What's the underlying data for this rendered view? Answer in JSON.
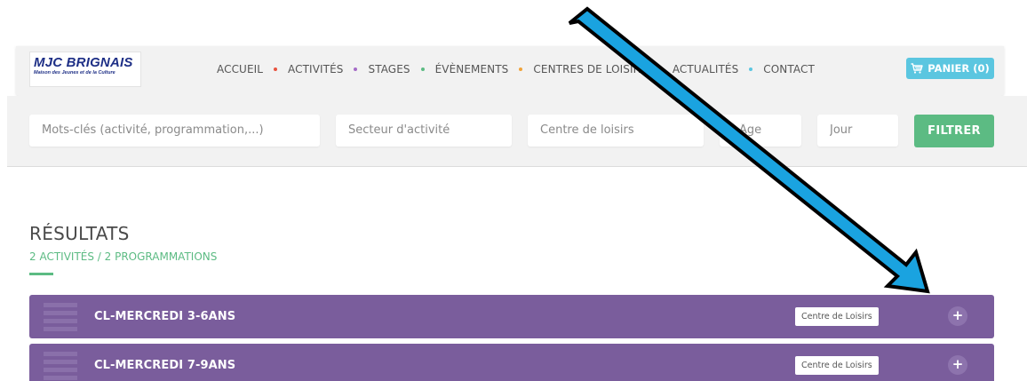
{
  "logo": {
    "title": "MJC BRIGNAIS",
    "subtitle": "Maison des Jeunes et de la Culture"
  },
  "nav": {
    "items": [
      {
        "label": "ACCUEIL",
        "dot": "#e8533f"
      },
      {
        "label": "ACTIVITÉS",
        "dot": "#a46bc7"
      },
      {
        "label": "STAGES",
        "dot": "#5cbb83"
      },
      {
        "label": "ÉVÈNEMENTS",
        "dot": "#f0a33a"
      },
      {
        "label": "CENTRES DE LOISIRS",
        "dot": "#f0a33a"
      },
      {
        "label": "ACTUALITÉS",
        "dot": "#5bc6e0"
      },
      {
        "label": "CONTACT",
        "dot": null
      }
    ],
    "cart_label": "PANIER (0)",
    "cart_icon": "cart-icon"
  },
  "filters": {
    "keywords_placeholder": "Mots-clés (activité, programmation,...)",
    "sector_placeholder": "Secteur d'activité",
    "center_placeholder": "Centre de loisirs",
    "age_placeholder": "Âge",
    "day_placeholder": "Jour",
    "submit_label": "FILTRER"
  },
  "results": {
    "title": "RÉSULTATS",
    "summary": "2 ACTIVITÉS / 2 PROGRAMMATIONS",
    "rows": [
      {
        "title": "CL-MERCREDI 3-6ANS",
        "badge": "Centre de Loisirs",
        "toggle": "+"
      },
      {
        "title": "CL-MERCREDI 7-9ANS",
        "badge": "Centre de Loisirs",
        "toggle": "+"
      }
    ]
  },
  "colors": {
    "accent_green": "#5cbb83",
    "cart_blue": "#5bc6e0",
    "row_purple": "#7a5d9c",
    "logo_navy": "#1e2f86",
    "arrow_blue": "#1aa3e0"
  }
}
